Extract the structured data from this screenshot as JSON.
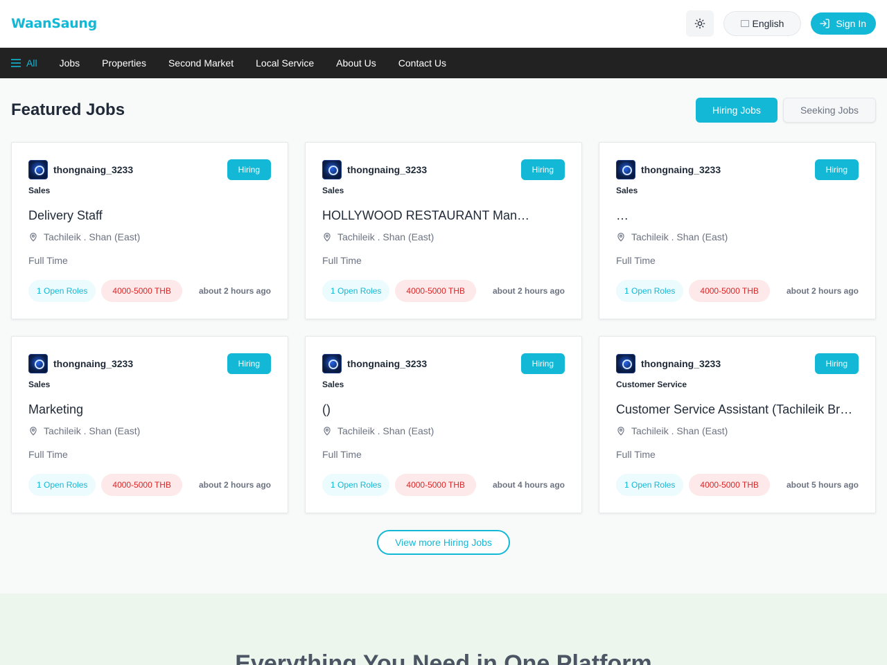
{
  "header": {
    "logo": "WaanSaung",
    "language_label": "English",
    "signin_label": "Sign In"
  },
  "nav": {
    "items": [
      {
        "label": "All",
        "active": true
      },
      {
        "label": "Jobs"
      },
      {
        "label": "Properties"
      },
      {
        "label": "Second Market"
      },
      {
        "label": "Local Service"
      },
      {
        "label": "About Us"
      },
      {
        "label": "Contact Us"
      }
    ]
  },
  "featured": {
    "title": "Featured Jobs",
    "tabs": [
      {
        "label": "Hiring Jobs",
        "active": true
      },
      {
        "label": "Seeking Jobs",
        "active": false
      }
    ],
    "view_more": "View more Hiring Jobs"
  },
  "jobs": [
    {
      "user": "thongnaing_3233",
      "badge": "Hiring",
      "category": "Sales",
      "title": " Delivery Staff ",
      "location": "Tachileik . Shan (East)",
      "type": "Full Time",
      "roles": "1 Open Roles",
      "salary": "4000-5000 THB",
      "posted": "about 2 hours ago"
    },
    {
      "user": "thongnaing_3233",
      "badge": "Hiring",
      "category": "Sales",
      "title": " HOLLYWOOD RESTAURANT  Man…",
      "location": "Tachileik . Shan (East)",
      "type": "Full Time",
      "roles": "1 Open Roles",
      "salary": "4000-5000 THB",
      "posted": "about 2 hours ago"
    },
    {
      "user": "thongnaing_3233",
      "badge": "Hiring",
      "category": "Sales",
      "title": "   …",
      "location": "Tachileik . Shan (East)",
      "type": "Full Time",
      "roles": "1 Open Roles",
      "salary": "4000-5000 THB",
      "posted": "about 2 hours ago"
    },
    {
      "user": "thongnaing_3233",
      "badge": "Hiring",
      "category": "Sales",
      "title": "Marketing   ",
      "location": "Tachileik . Shan (East)",
      "type": "Full Time",
      "roles": "1 Open Roles",
      "salary": "4000-5000 THB",
      "posted": "about 2 hours ago"
    },
    {
      "user": "thongnaing_3233",
      "badge": "Hiring",
      "category": "Sales",
      "title": "()",
      "location": "Tachileik . Shan (East)",
      "type": "Full Time",
      "roles": "1 Open Roles",
      "salary": "4000-5000 THB",
      "posted": "about 4 hours ago"
    },
    {
      "user": "thongnaing_3233",
      "badge": "Hiring",
      "category": "Customer Service",
      "title": "Customer Service Assistant (Tachileik Br…",
      "location": "Tachileik . Shan (East)",
      "type": "Full Time",
      "roles": "1 Open Roles",
      "salary": "4000-5000 THB",
      "posted": "about 5 hours ago"
    }
  ],
  "platform": {
    "title": "Everything You Need in One Platform"
  },
  "colors": {
    "accent": "#12b8d6",
    "nav_bg": "#222222",
    "salary_text": "#dc2626"
  }
}
